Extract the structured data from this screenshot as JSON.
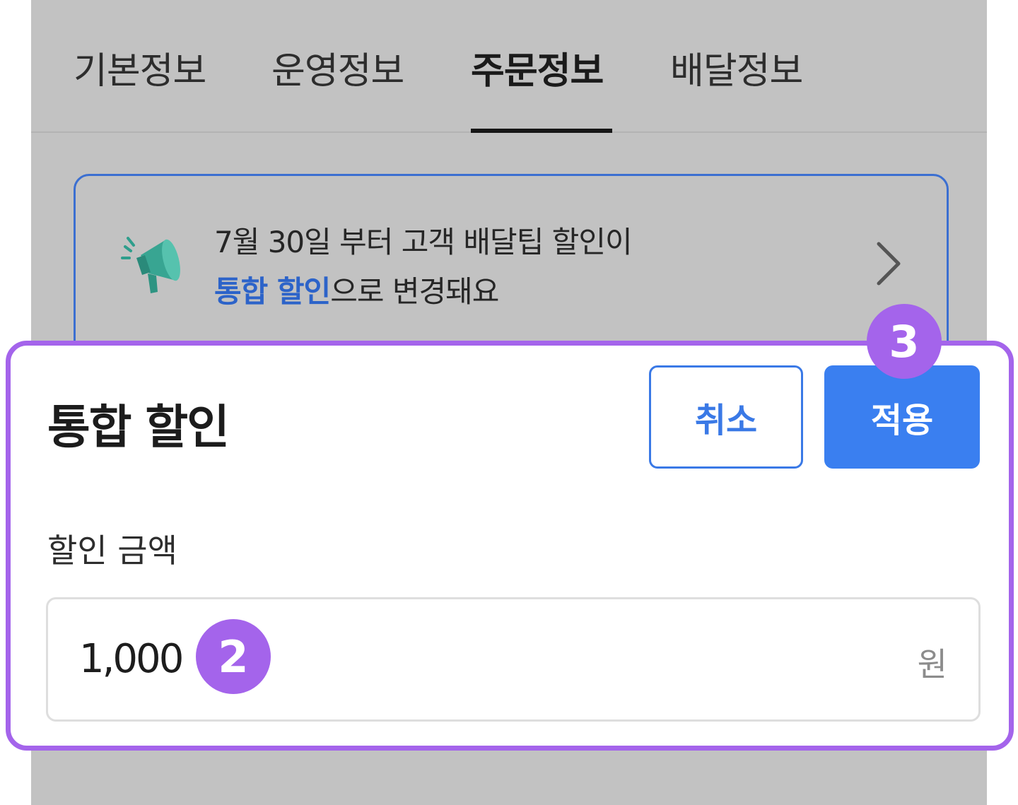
{
  "tabs": [
    {
      "label": "기본정보"
    },
    {
      "label": "운영정보"
    },
    {
      "label": "주문정보"
    },
    {
      "label": "배달정보"
    }
  ],
  "notice": {
    "line1": "7월 30일 부터 고객 배달팁 할인이",
    "highlight": "통합 할인",
    "line2_rest": "으로 변경돼요",
    "icon": "megaphone-icon"
  },
  "panel": {
    "title": "통합 할인",
    "cancel_label": "취소",
    "apply_label": "적용",
    "field_label": "할인 금액",
    "input_value": "1,000",
    "unit": "원"
  },
  "badges": {
    "step2": "2",
    "step3": "3"
  },
  "colors": {
    "accent": "#3a7ff0",
    "highlight_text": "#2c63c9",
    "annotation": "#a464eb",
    "overlay": "#c2c2c2"
  }
}
